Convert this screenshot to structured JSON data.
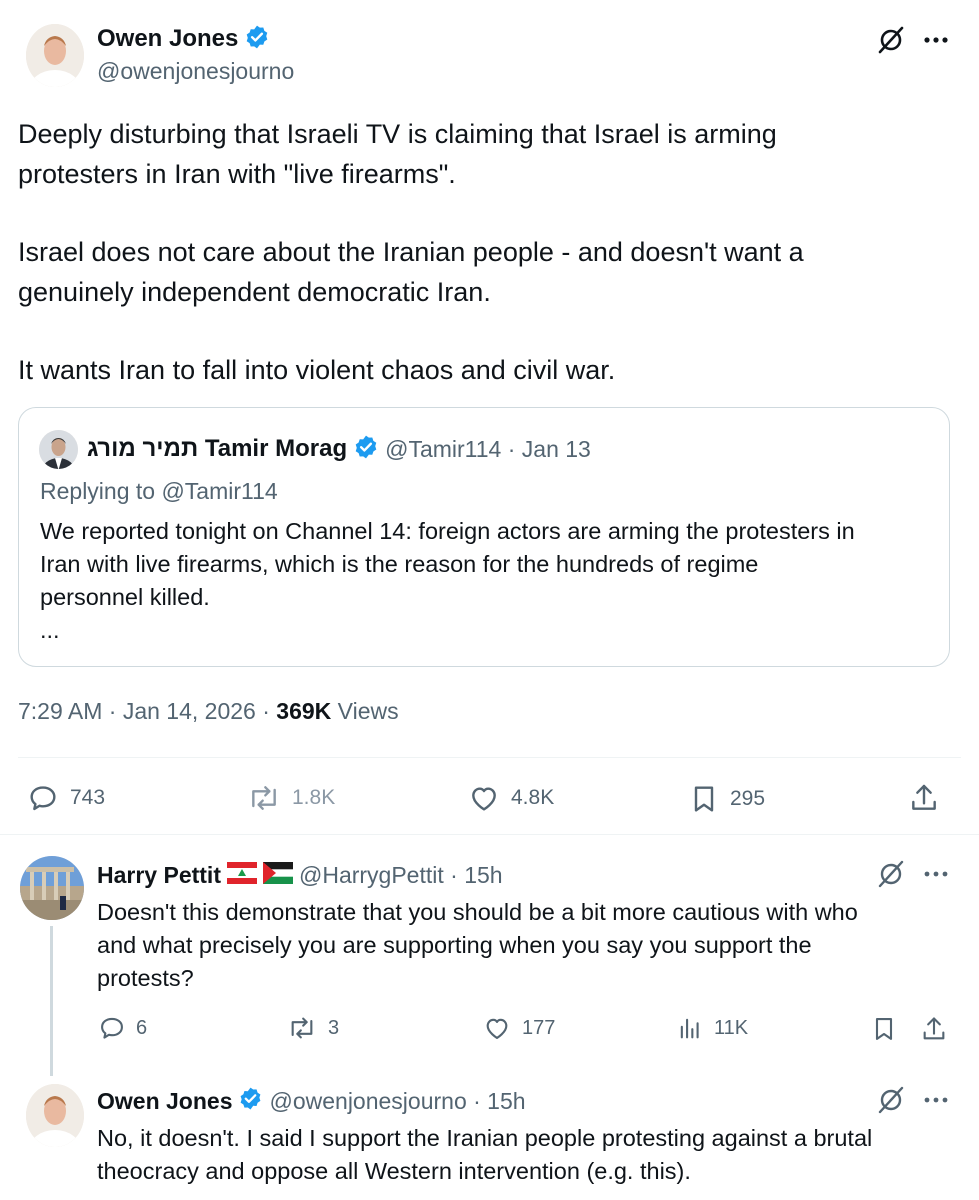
{
  "main_tweet": {
    "author_name": "Owen Jones",
    "handle": "@owenjonesjourno",
    "text_lines": [
      "Deeply disturbing that Israeli TV is claiming that Israel is arming",
      "protesters in Iran with \"live firearms\".",
      "Israel does not care about the Iranian people - and doesn't want a",
      "genuinely independent democratic Iran.",
      "It wants Iran to fall into violent chaos and civil war."
    ],
    "quoted": {
      "author_name": "תמיר מורג Tamir Morag",
      "handle_time": "@Tamir114 · Jan 13",
      "replying_to": "Replying to @Tamir114",
      "text_lines": [
        "We reported tonight on Channel 14: foreign actors are arming the protesters in",
        "Iran with live firearms, which is the reason for the hundreds of regime",
        "personnel killed.",
        "..."
      ]
    },
    "timestamp": "7:29 AM · Jan 14, 2026 · ",
    "views_count": "369K",
    "views_label": " Views",
    "actions": {
      "replies": "743",
      "reposts": "1.8K",
      "likes": "4.8K",
      "bookmarks": "295"
    }
  },
  "reply_1": {
    "author_name": "Harry Pettit",
    "handle_time": "@HarrygPettit · 15h",
    "text_lines": [
      "Doesn't this demonstrate that you should be a bit more cautious with who",
      "and what precisely you are supporting when you say you support the",
      "protests?"
    ],
    "actions": {
      "replies": "6",
      "reposts": "3",
      "likes": "177",
      "views": "11K"
    }
  },
  "reply_2": {
    "author_name": "Owen Jones",
    "handle_time": "@owenjonesjourno · 15h",
    "text_lines": [
      "No, it doesn't. I said I support the Iranian people protesting against a brutal",
      "theocracy and oppose all Western intervention (e.g. this)."
    ]
  },
  "colors": {
    "verified": "#1d9bf0",
    "muted": "#536471",
    "border": "#cfd9de"
  },
  "icons": [
    "verified-badge-icon",
    "grok-icon",
    "more-icon",
    "reply-icon",
    "repost-icon",
    "like-icon",
    "bookmark-icon",
    "share-icon",
    "views-icon"
  ]
}
